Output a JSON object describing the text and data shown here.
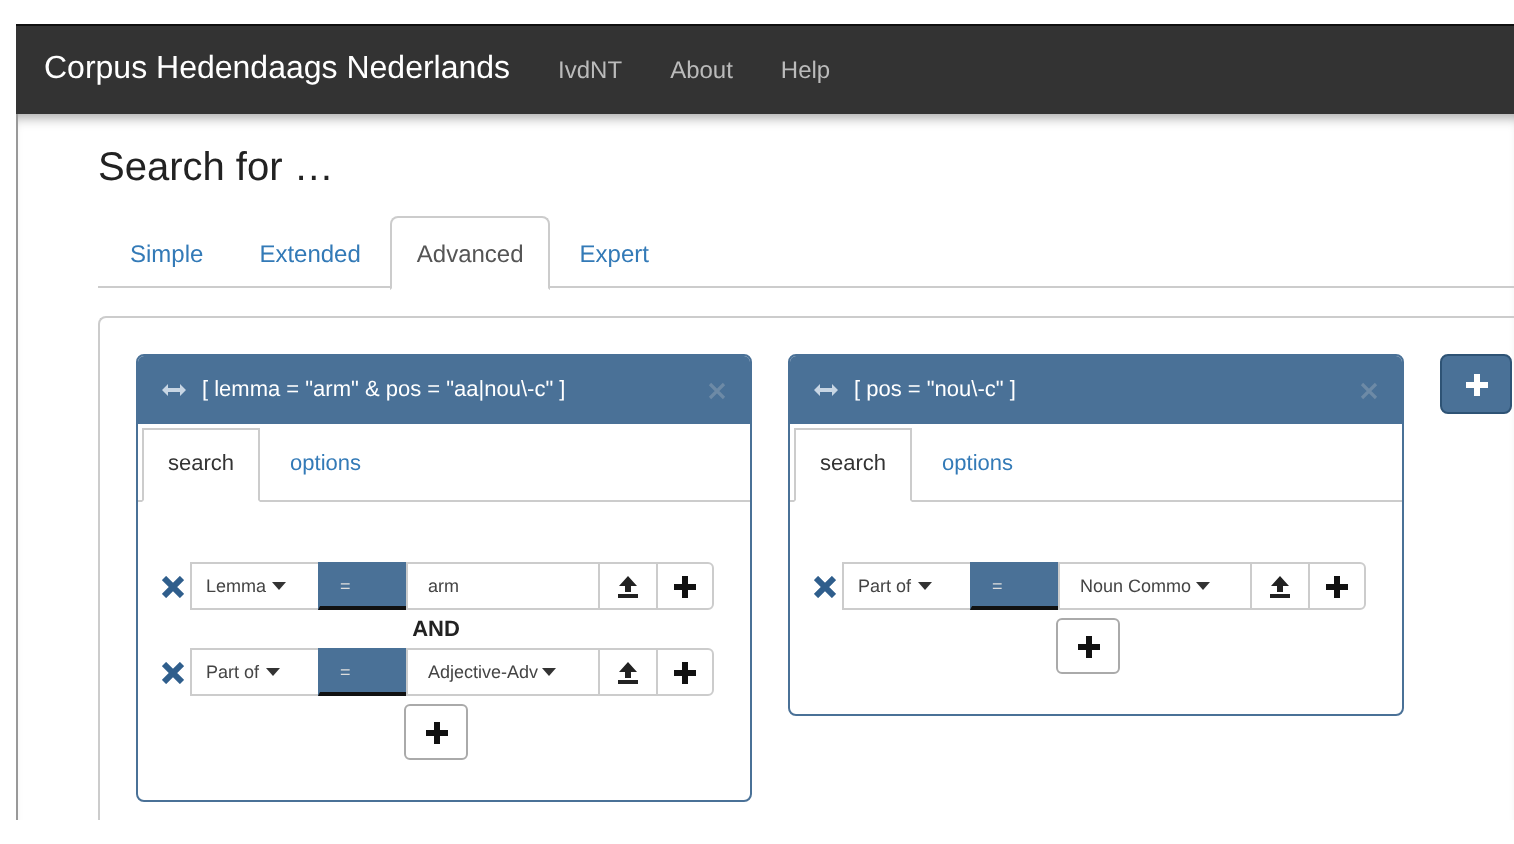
{
  "navbar": {
    "brand": "Corpus Hedendaags Nederlands",
    "links": [
      "IvdNT",
      "About",
      "Help"
    ]
  },
  "heading": "Search for …",
  "tabs": [
    {
      "label": "Simple",
      "selected": false
    },
    {
      "label": "Extended",
      "selected": false
    },
    {
      "label": "Advanced",
      "selected": true
    },
    {
      "label": "Expert",
      "selected": false
    }
  ],
  "blocks": [
    {
      "title": "[ lemma = \"arm\" & pos = \"aa|nou\\-c\" ]",
      "tabs": [
        {
          "label": "search",
          "selected": true
        },
        {
          "label": "options",
          "selected": false
        }
      ],
      "rows": [
        {
          "kind": "clause",
          "field": "Lemma",
          "operator": "=",
          "value": {
            "kind": "input",
            "text": "arm"
          }
        },
        {
          "kind": "connector",
          "label": "AND"
        },
        {
          "kind": "clause",
          "field": "Part of",
          "operator": "=",
          "value": {
            "kind": "dropdown",
            "text": "Adjective-Adv"
          }
        }
      ]
    },
    {
      "title": "[ pos = \"nou\\-c\" ]",
      "tabs": [
        {
          "label": "search",
          "selected": true
        },
        {
          "label": "options",
          "selected": false
        }
      ],
      "rows": [
        {
          "kind": "clause",
          "field": "Part of",
          "operator": "=",
          "value": {
            "kind": "dropdown",
            "text": "Noun Commo"
          }
        }
      ]
    }
  ]
}
